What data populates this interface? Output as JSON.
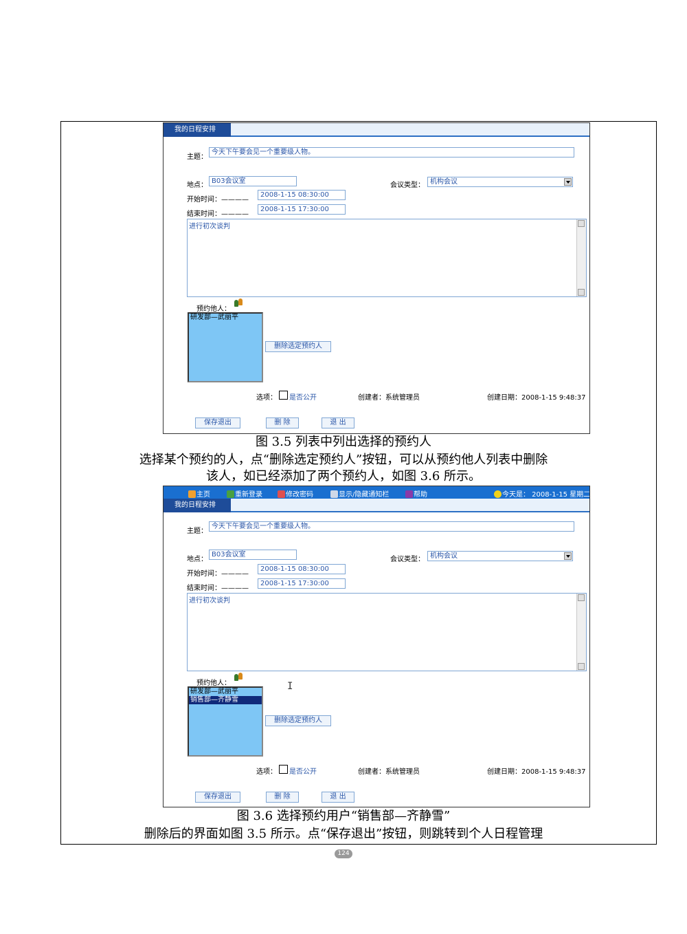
{
  "figure1": {
    "tab": "我的日程安排",
    "subject_label": "主题：",
    "subject_value": "今天下午要会见一个重要级人物。",
    "location_label": "地点：",
    "location_value": "B03会议室",
    "meeting_type_label": "会议类型：",
    "meeting_type_value": "机构会议",
    "start_label": "开始时间：————",
    "start_value": "2008-1-15 08:30:00",
    "end_label": "结束时间：————",
    "end_value": "2008-1-15 17:30:00",
    "content": "进行初次谈判",
    "invitees_label": "预约他人：",
    "invitees": [
      "研发部—武丽平"
    ],
    "delete_invitee_button": "删除选定预约人",
    "option_label": "选项：",
    "public_label": "是否公开",
    "creator_label": "创建者：",
    "creator_value": "系统管理员",
    "created_label": "创建日期：",
    "created_value": "2008-1-15 9:48:37",
    "save_button": "保存退出",
    "delete_button": "删 除",
    "exit_button": "退 出",
    "caption": "图 3.5  列表中列出选择的预约人"
  },
  "body_text": {
    "line1": "选择某个预约的人，点“删除选定预约人”按钮，可以从预约他人列表中删除",
    "line2": "该人，如已经添加了两个预约人，如图 3.6 所示。"
  },
  "figure2": {
    "menu": {
      "home": "主页",
      "relogin": "重新登录",
      "change_password": "修改密码",
      "toggle_notice": "显示/隐藏通知栏",
      "help": "帮助",
      "today": "今天是：  2008-1-15 星期二"
    },
    "tab": "我的日程安排",
    "subject_label": "主题：",
    "subject_value": "今天下午要会见一个重要级人物。",
    "location_label": "地点：",
    "location_value": "B03会议室",
    "meeting_type_label": "会议类型：",
    "meeting_type_value": "机构会议",
    "start_label": "开始时间：————",
    "start_value": "2008-1-15 08:30:00",
    "end_label": "结束时间：————",
    "end_value": "2008-1-15 17:30:00",
    "content": "进行初次谈判",
    "invitees_label": "预约他人：",
    "invitees": [
      "研发部—武丽平",
      "销售部—齐静雪"
    ],
    "delete_invitee_button": "删除选定预约人",
    "option_label": "选项：",
    "public_label": "是否公开",
    "creator_label": "创建者：",
    "creator_value": "系统管理员",
    "created_label": "创建日期：",
    "created_value": "2008-1-15 9:48:37",
    "save_button": "保存退出",
    "delete_button": "删 除",
    "exit_button": "退 出",
    "caption": "图 3.6  选择预约用户“销售部—齐静雪”"
  },
  "footer_text": "删除后的界面如图 3.5 所示。点“保存退出”按钮，则跳转到个人日程管理",
  "page_number": "124",
  "colors": {
    "menu_bar": "#1a6fd0",
    "tab": "#1e4c99",
    "list_bg": "#7ec6f5",
    "selected_row": "#102a7a",
    "field_text": "#2a56a8"
  }
}
